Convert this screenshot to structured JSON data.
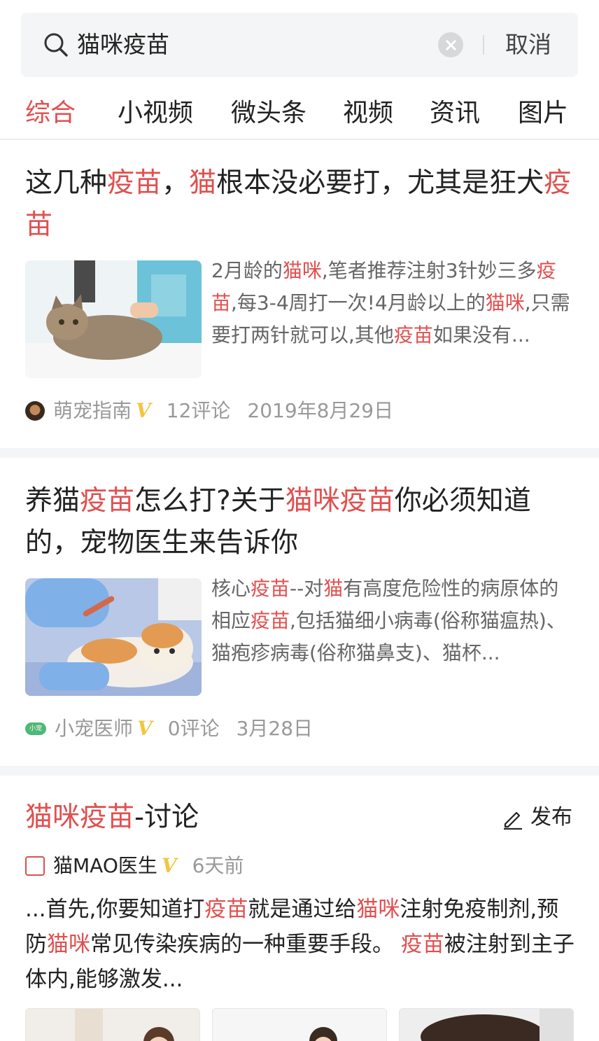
{
  "search": {
    "query": "猫咪疫苗",
    "cancel_label": "取消"
  },
  "tabs": [
    {
      "label": "综合",
      "active": true
    },
    {
      "label": "小视频",
      "active": false
    },
    {
      "label": "微头条",
      "active": false
    },
    {
      "label": "视频",
      "active": false
    },
    {
      "label": "资讯",
      "active": false
    },
    {
      "label": "图片",
      "active": false
    }
  ],
  "articles": [
    {
      "title_parts": [
        {
          "t": "这几种",
          "hl": false
        },
        {
          "t": "疫苗",
          "hl": true
        },
        {
          "t": "，",
          "hl": false
        },
        {
          "t": "猫",
          "hl": true
        },
        {
          "t": "根本没必要打，尤其是狂犬",
          "hl": false
        },
        {
          "t": "疫苗",
          "hl": true
        }
      ],
      "snippet_parts": [
        {
          "t": "2月龄的",
          "hl": false
        },
        {
          "t": "猫咪",
          "hl": true
        },
        {
          "t": ",笔者推荐注射3针妙三多",
          "hl": false
        },
        {
          "t": "疫苗",
          "hl": true
        },
        {
          "t": ",每3-4周打一次!4月龄以上的",
          "hl": false
        },
        {
          "t": "猫咪",
          "hl": true
        },
        {
          "t": ",只需要打两针就可以,其他",
          "hl": false
        },
        {
          "t": "疫苗",
          "hl": true
        },
        {
          "t": "如果没有...",
          "hl": false
        }
      ],
      "author": "萌宠指南",
      "verified_mark": "V",
      "comments": "12评论",
      "date": "2019年8月29日",
      "thumbnail_icon": "cat-vet-photo"
    },
    {
      "title_parts": [
        {
          "t": "养猫",
          "hl": false
        },
        {
          "t": "疫苗",
          "hl": true
        },
        {
          "t": "怎么打?关于",
          "hl": false
        },
        {
          "t": "猫咪疫苗",
          "hl": true
        },
        {
          "t": "你必须知道的，宠物医生来告诉你",
          "hl": false
        }
      ],
      "snippet_parts": [
        {
          "t": "核心",
          "hl": false
        },
        {
          "t": "疫苗",
          "hl": true
        },
        {
          "t": "--对",
          "hl": false
        },
        {
          "t": "猫",
          "hl": true
        },
        {
          "t": "有高度危险性的病原体的相应",
          "hl": false
        },
        {
          "t": "疫苗",
          "hl": true
        },
        {
          "t": ",包括猫细小病毒(俗称猫瘟热)、猫疱疹病毒(俗称猫鼻支)、猫杯...",
          "hl": false
        }
      ],
      "author": "小宠医师",
      "avatar_text": "小宠",
      "verified_mark": "V",
      "comments": "0评论",
      "date": "3月28日",
      "thumbnail_icon": "cat-injection-photo"
    }
  ],
  "discussion": {
    "title_highlight": "猫咪疫苗",
    "title_suffix": "-讨论",
    "publish_label": "发布",
    "author": "猫MAO医生",
    "verified_mark": "V",
    "time": "6天前",
    "body_parts": [
      {
        "t": "...首先,你要知道打",
        "hl": false
      },
      {
        "t": "疫苗",
        "hl": true
      },
      {
        "t": "就是通过给",
        "hl": false
      },
      {
        "t": "猫咪",
        "hl": true
      },
      {
        "t": "注射免疫制剂,预防",
        "hl": false
      },
      {
        "t": "猫咪",
        "hl": true
      },
      {
        "t": "常见传染疾病的一种重要手段。 ",
        "hl": false
      },
      {
        "t": "疫苗",
        "hl": true
      },
      {
        "t": "被注射到主子体内,能够激发...",
        "hl": false
      }
    ]
  },
  "colors": {
    "accent": "#e0504f",
    "verified": "#f2c541",
    "secondary_text": "#999999"
  }
}
